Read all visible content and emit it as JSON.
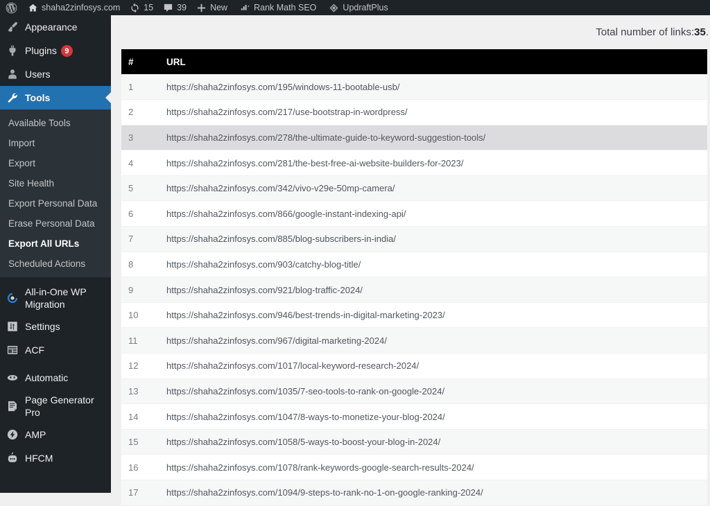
{
  "adminbar": {
    "items": [
      {
        "icon": "wordpress-logo-icon",
        "label": ""
      },
      {
        "icon": "home-icon",
        "label": "shaha2zinfosys.com"
      },
      {
        "icon": "update-icon",
        "label": "15"
      },
      {
        "icon": "comment-bubble-icon",
        "label": "39"
      },
      {
        "icon": "plus-icon",
        "label": "New"
      },
      {
        "icon": "rank-math-icon",
        "label": "Rank Math SEO"
      },
      {
        "icon": "updraftplus-icon",
        "label": "UpdraftPlus"
      }
    ]
  },
  "sidebar": {
    "top_items": [
      {
        "icon": "appearance-brush-icon",
        "label": "Appearance",
        "badge": null,
        "current": false
      },
      {
        "icon": "plugins-plug-icon",
        "label": "Plugins",
        "badge": "9",
        "current": false
      },
      {
        "icon": "users-icon",
        "label": "Users",
        "badge": null,
        "current": false
      },
      {
        "icon": "tools-wrench-icon",
        "label": "Tools",
        "badge": null,
        "current": true
      }
    ],
    "submenu": [
      {
        "label": "Available Tools",
        "current": false
      },
      {
        "label": "Import",
        "current": false
      },
      {
        "label": "Export",
        "current": false
      },
      {
        "label": "Site Health",
        "current": false
      },
      {
        "label": "Export Personal Data",
        "current": false
      },
      {
        "label": "Erase Personal Data",
        "current": false
      },
      {
        "label": "Export All URLs",
        "current": true
      },
      {
        "label": "Scheduled Actions",
        "current": false
      }
    ],
    "plugin_items": [
      {
        "icon": "all-in-one-wp-migration-icon",
        "label": "All-in-One WP Migration"
      },
      {
        "icon": "settings-sliders-icon",
        "label": "Settings"
      },
      {
        "icon": "acf-grid-icon",
        "label": "ACF"
      },
      {
        "icon": "automatic-face-icon",
        "label": "Automatic"
      },
      {
        "icon": "page-generator-document-icon",
        "label": "Page Generator Pro"
      },
      {
        "icon": "amp-lightning-icon",
        "label": "AMP"
      },
      {
        "icon": "hfcm-robot-icon",
        "label": "HFCM"
      }
    ]
  },
  "main": {
    "total_label_prefix": "Total number of links: ",
    "total_count": "35",
    "total_label_suffix": ".",
    "table": {
      "columns": [
        "#",
        "URL"
      ],
      "hovered_row_index": 3,
      "rows": [
        {
          "num": "1",
          "url": "https://shaha2zinfosys.com/195/windows-11-bootable-usb/"
        },
        {
          "num": "2",
          "url": "https://shaha2zinfosys.com/217/use-bootstrap-in-wordpress/"
        },
        {
          "num": "3",
          "url": "https://shaha2zinfosys.com/278/the-ultimate-guide-to-keyword-suggestion-tools/"
        },
        {
          "num": "4",
          "url": "https://shaha2zinfosys.com/281/the-best-free-ai-website-builders-for-2023/"
        },
        {
          "num": "5",
          "url": "https://shaha2zinfosys.com/342/vivo-v29e-50mp-camera/"
        },
        {
          "num": "6",
          "url": "https://shaha2zinfosys.com/866/google-instant-indexing-api/"
        },
        {
          "num": "7",
          "url": "https://shaha2zinfosys.com/885/blog-subscribers-in-india/"
        },
        {
          "num": "8",
          "url": "https://shaha2zinfosys.com/903/catchy-blog-title/"
        },
        {
          "num": "9",
          "url": "https://shaha2zinfosys.com/921/blog-traffic-2024/"
        },
        {
          "num": "10",
          "url": "https://shaha2zinfosys.com/946/best-trends-in-digital-marketing-2023/"
        },
        {
          "num": "11",
          "url": "https://shaha2zinfosys.com/967/digital-marketing-2024/"
        },
        {
          "num": "12",
          "url": "https://shaha2zinfosys.com/1017/local-keyword-research-2024/"
        },
        {
          "num": "13",
          "url": "https://shaha2zinfosys.com/1035/7-seo-tools-to-rank-on-google-2024/"
        },
        {
          "num": "14",
          "url": "https://shaha2zinfosys.com/1047/8-ways-to-monetize-your-blog-2024/"
        },
        {
          "num": "15",
          "url": "https://shaha2zinfosys.com/1058/5-ways-to-boost-your-blog-in-2024/"
        },
        {
          "num": "16",
          "url": "https://shaha2zinfosys.com/1078/rank-keywords-google-search-results-2024/"
        },
        {
          "num": "17",
          "url": "https://shaha2zinfosys.com/1094/9-steps-to-rank-no-1-on-google-ranking-2024/"
        }
      ]
    }
  },
  "colors": {
    "admin_dark": "#1d2327",
    "submenu_dark": "#2c3338",
    "accent_blue": "#2271b1",
    "badge_red": "#d63638",
    "content_bg": "#f0f0f1",
    "table_header": "#000000",
    "row_alt": "#f6f7f7",
    "row_hover": "#dcdcde"
  }
}
